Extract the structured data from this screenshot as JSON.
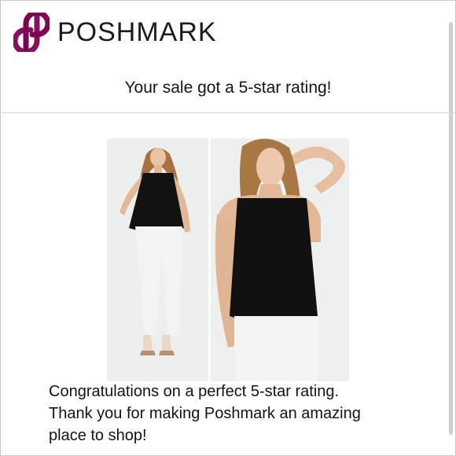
{
  "brand": {
    "name": "POSHMARK",
    "logo_icon": "poshmark-logo-icon",
    "color": "#7f0353"
  },
  "email": {
    "headline": "Your sale got a 5-star rating!",
    "product_photos": [
      {
        "name": "product-photo-full-body",
        "depicts": "model in black top"
      },
      {
        "name": "product-photo-closeup",
        "depicts": "model in black top"
      }
    ],
    "message_line1": "Congratulations on a perfect 5-star rating.",
    "message_line2": "Thank you for making Poshmark an amazing",
    "message_line3": "place to shop!"
  }
}
